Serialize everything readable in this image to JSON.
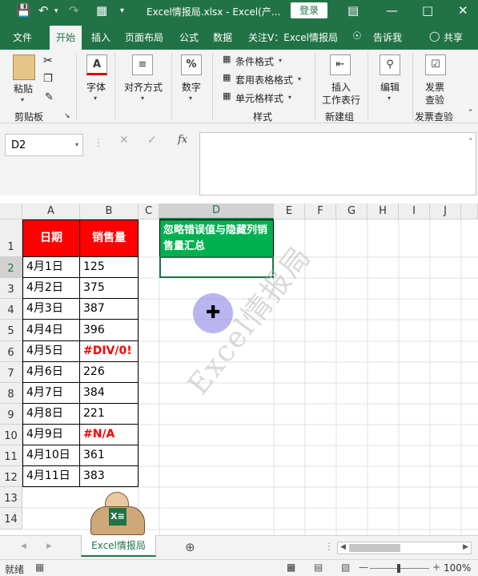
{
  "titlebar": {
    "title": "Excel情报局.xlsx  -  Excel(产...",
    "login": "登录"
  },
  "tabs": [
    "文件",
    "开始",
    "插入",
    "页面布局",
    "公式",
    "数据",
    "关注V：Excel情报局",
    "告诉我",
    "共享"
  ],
  "ribbon": {
    "paste": "粘贴",
    "clipboard": "剪贴板",
    "font": "字体",
    "align": "对齐方式",
    "number": "数字",
    "cond_format": "条件格式",
    "table_format": "套用表格格式",
    "cell_style": "单元格样式",
    "styles": "样式",
    "insert_line1": "插入",
    "insert_line2": "工作表行",
    "new_group": "新建组",
    "edit": "编辑",
    "invoice_line1": "发票",
    "invoice_line2": "查验",
    "invoice_group": "发票查验",
    "percent": "%",
    "font_glyph": "A"
  },
  "formula_bar": {
    "name_box": "D2",
    "fx": "fx",
    "content": ""
  },
  "columns": [
    "A",
    "B",
    "C",
    "D",
    "E",
    "F",
    "G",
    "H",
    "I",
    "J"
  ],
  "rows": [
    "1",
    "2",
    "3",
    "4",
    "5",
    "6",
    "7",
    "8",
    "9",
    "10",
    "11",
    "12",
    "13",
    "14"
  ],
  "table": {
    "header_date": "日期",
    "header_sales": "销售量",
    "header_summary": "忽略错误值与隐藏列销售量汇总",
    "data": [
      {
        "date": "4月1日",
        "sales": "125"
      },
      {
        "date": "4月2日",
        "sales": "375"
      },
      {
        "date": "4月3日",
        "sales": "387"
      },
      {
        "date": "4月4日",
        "sales": "396"
      },
      {
        "date": "4月5日",
        "sales": "#DIV/0!"
      },
      {
        "date": "4月6日",
        "sales": "226"
      },
      {
        "date": "4月7日",
        "sales": "384"
      },
      {
        "date": "4月8日",
        "sales": "221"
      },
      {
        "date": "4月9日",
        "sales": "#N/A"
      },
      {
        "date": "4月10日",
        "sales": "361"
      },
      {
        "date": "4月11日",
        "sales": "383"
      }
    ]
  },
  "watermark": "Excel情报局",
  "logo_text": "X≡",
  "sheet_tab": "Excel情报局",
  "status": {
    "ready": "就绪",
    "zoom": "100%"
  },
  "colors": {
    "excel_green": "#217346",
    "header_red": "#ff0000",
    "header_green": "#00b050",
    "error_red": "#ff0000"
  }
}
